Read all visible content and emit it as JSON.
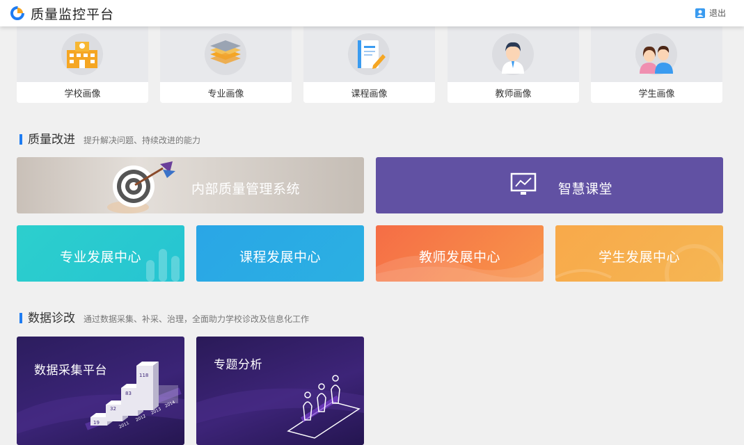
{
  "header": {
    "title": "质量监控平台",
    "logout_label": "退出"
  },
  "portraits": [
    {
      "label": "学校画像",
      "icon": "school-building-icon"
    },
    {
      "label": "专业画像",
      "icon": "layers-icon"
    },
    {
      "label": "课程画像",
      "icon": "notebook-pen-icon"
    },
    {
      "label": "教师画像",
      "icon": "teacher-avatar-icon"
    },
    {
      "label": "学生画像",
      "icon": "students-avatar-icon"
    }
  ],
  "quality": {
    "title": "质量改进",
    "desc": "提升解决问题、持续改进的能力",
    "tiles": {
      "internal": "内部质量管理系统",
      "smart": "智慧课堂",
      "major": "专业发展中心",
      "course": "课程发展中心",
      "teacher": "教师发展中心",
      "student": "学生发展中心"
    }
  },
  "data_section": {
    "title": "数据诊改",
    "desc": "通过数据采集、补采、治理，全面助力学校诊改及信息化工作",
    "tiles": {
      "collect": "数据采集平台",
      "topic": "专题分析"
    },
    "bar_values": [
      "19",
      "32",
      "83",
      "118"
    ],
    "years": [
      "2011",
      "2012",
      "2013",
      "2014"
    ]
  },
  "colors": {
    "accent": "#1e7cf2",
    "smart_bg": "#6151a3",
    "major_bg": "#2ccfcd",
    "course_bg": "#2aa6e6",
    "teacher_bg": "#f56d46",
    "student_bg": "#f8a94a",
    "data_bg": "#2c1d5e"
  }
}
